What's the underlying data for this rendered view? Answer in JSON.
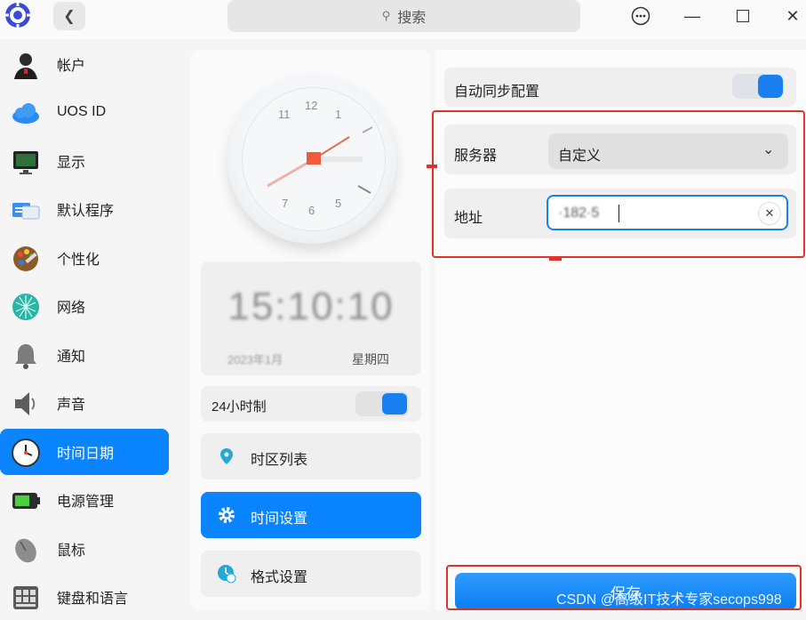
{
  "search": {
    "placeholder": "搜索"
  },
  "sidebar": {
    "items": [
      {
        "label": "帐户",
        "icon": "user-icon"
      },
      {
        "label": "UOS ID",
        "icon": "cloud-icon"
      },
      {
        "label": "显示",
        "icon": "monitor-icon"
      },
      {
        "label": "默认程序",
        "icon": "default-apps-icon"
      },
      {
        "label": "个性化",
        "icon": "palette-icon"
      },
      {
        "label": "网络",
        "icon": "network-icon"
      },
      {
        "label": "通知",
        "icon": "bell-icon"
      },
      {
        "label": "声音",
        "icon": "speaker-icon"
      },
      {
        "label": "时间日期",
        "icon": "clock-icon",
        "active": true
      },
      {
        "label": "电源管理",
        "icon": "battery-icon"
      },
      {
        "label": "鼠标",
        "icon": "mouse-icon"
      },
      {
        "label": "键盘和语言",
        "icon": "keyboard-icon"
      }
    ]
  },
  "clock": {
    "numbers": [
      "12",
      "11",
      "1",
      "7",
      "6",
      "5"
    ]
  },
  "time_card": {
    "time": "15:10:10",
    "date": "2023年1月",
    "weekday": "星期四"
  },
  "hour24": {
    "label": "24小时制",
    "enabled": true
  },
  "mid_menu": [
    {
      "label": "时区列表",
      "icon": "location-pin-icon"
    },
    {
      "label": "时间设置",
      "icon": "gear-icon",
      "active": true
    },
    {
      "label": "格式设置",
      "icon": "format-clock-icon"
    }
  ],
  "settings": {
    "autosync_label": "自动同步配置",
    "autosync_enabled": true,
    "server_label": "服务器",
    "server_value": "自定义",
    "address_label": "地址",
    "address_value": "·182·5",
    "save_label": "保存"
  },
  "watermark": "CSDN @高级IT技术专家secops998",
  "colors": {
    "accent": "#0a84ff",
    "highlight": "#e0322b"
  }
}
